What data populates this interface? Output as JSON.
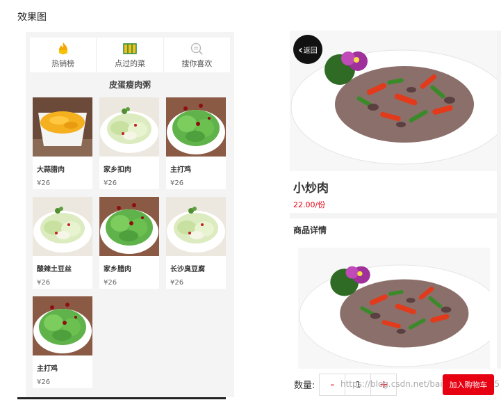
{
  "page": {
    "heading": "效果图"
  },
  "tabs": [
    {
      "label": "热销榜",
      "icon": "fire-hot-icon"
    },
    {
      "label": "点过的菜",
      "icon": "menu-book-icon"
    },
    {
      "label": "搜你喜欢",
      "icon": "search-icon"
    }
  ],
  "section": {
    "title": "皮蛋瘦肉粥"
  },
  "items": [
    {
      "name": "大蒜腊肉",
      "price": "¥26",
      "image": "egg-dish"
    },
    {
      "name": "家乡扣肉",
      "price": "¥26",
      "image": "cabbage-dish"
    },
    {
      "name": "主打鸡",
      "price": "¥26",
      "image": "greens-dish"
    },
    {
      "name": "酸辣土豆丝",
      "price": "¥26",
      "image": "cabbage-dish"
    },
    {
      "name": "家乡腊肉",
      "price": "¥26",
      "image": "greens-dish"
    },
    {
      "name": "长沙臭豆腐",
      "price": "¥26",
      "image": "cabbage-dish"
    },
    {
      "name": "主打鸡",
      "price": "¥26",
      "image": "greens-dish"
    }
  ],
  "detail": {
    "back_label": "返回",
    "name": "小炒肉",
    "price": "22.00/份",
    "section_title": "商品详情"
  },
  "cart": {
    "qty_label": "数量:",
    "minus": "-",
    "qty": "1",
    "plus": "+",
    "add_label": "加入购物车",
    "watermark": "https://blog.csdn.net/baidu_41086035"
  },
  "colors": {
    "accent": "#e60012",
    "panel_bg": "#f4f4f4"
  }
}
